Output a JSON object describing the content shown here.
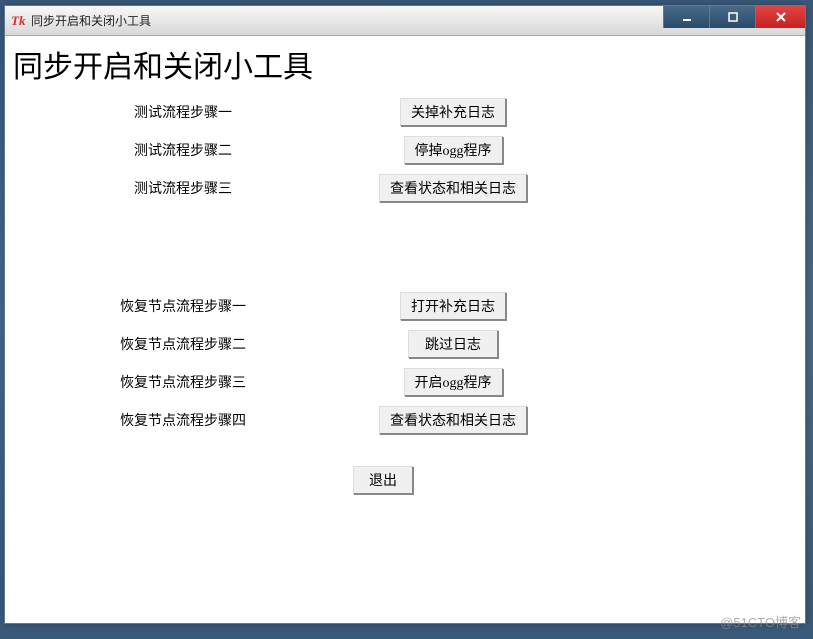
{
  "window": {
    "title": "同步开启和关闭小工具"
  },
  "heading": "同步开启和关闭小工具",
  "group1": {
    "rows": [
      {
        "label": "测试流程步骤一",
        "button": "关掉补充日志"
      },
      {
        "label": "测试流程步骤二",
        "button": "停掉ogg程序"
      },
      {
        "label": "测试流程步骤三",
        "button": "查看状态和相关日志"
      }
    ]
  },
  "group2": {
    "rows": [
      {
        "label": "恢复节点流程步骤一",
        "button": "打开补充日志"
      },
      {
        "label": "恢复节点流程步骤二",
        "button": "跳过日志"
      },
      {
        "label": "恢复节点流程步骤三",
        "button": "开启ogg程序"
      },
      {
        "label": "恢复节点流程步骤四",
        "button": "查看状态和相关日志"
      }
    ]
  },
  "exit_button": "退出",
  "watermark": "@51CTO博客"
}
